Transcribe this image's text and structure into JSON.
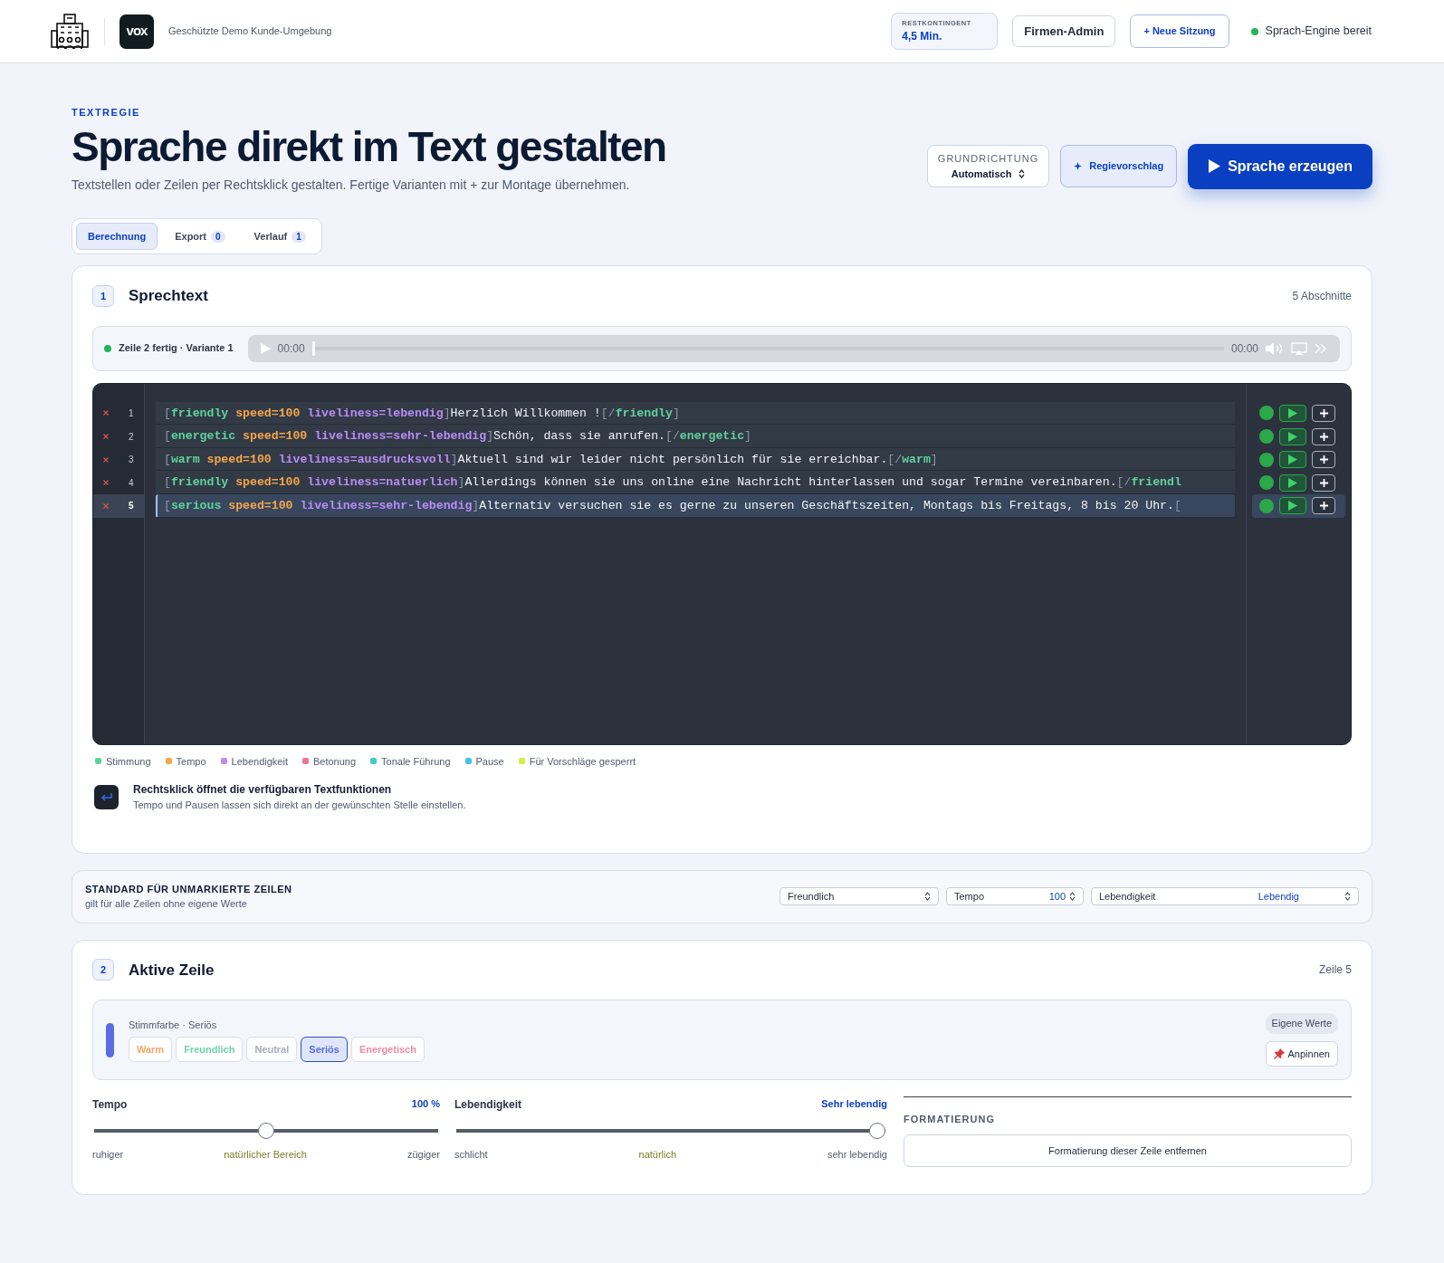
{
  "header": {
    "logo_text": "vox",
    "environment": "Geschützte Demo Kunde-Umgebung",
    "quota": {
      "label": "RESTKONTINGENT",
      "value": "4,5 Min."
    },
    "admin_button": "Firmen-Admin",
    "new_session_button": "+ Neue Sitzung",
    "engine_status": "Sprach-Engine bereit"
  },
  "intro": {
    "eyebrow": "TEXTREGIE",
    "title": "Sprache direkt im Text gestalten",
    "subtitle": "Textstellen oder Zeilen per Rechtsklick gestalten. Fertige Varianten mit + zur Montage übernehmen.",
    "direction": {
      "label": "GRUNDRICHTUNG",
      "value": "Automatisch"
    },
    "suggest_button": "Regievorschlag",
    "generate_button": "Sprache erzeugen"
  },
  "tabs": [
    {
      "label": "Berechnung",
      "selected": true
    },
    {
      "label": "Export",
      "count": "0",
      "selected": false
    },
    {
      "label": "Verlauf",
      "count": "1",
      "selected": false
    }
  ],
  "script_section": {
    "number": "1",
    "title": "Sprechtext",
    "meta": "5 Abschnitte",
    "player": {
      "status": "Zeile 2 fertig · Variante 1",
      "current_time": "00:00",
      "duration": "00:00"
    },
    "lines": [
      {
        "number": "1",
        "selected": false,
        "tokens": [
          {
            "kind": "punct",
            "text": "["
          },
          {
            "kind": "mood",
            "text": "friendly "
          },
          {
            "kind": "speed",
            "text": "speed=100 "
          },
          {
            "kind": "liveliness",
            "text": "liveliness=lebendig"
          },
          {
            "kind": "punct",
            "text": "]"
          },
          {
            "kind": "text",
            "text": "Herzlich Willkommen !"
          },
          {
            "kind": "punct",
            "text": "[/"
          },
          {
            "kind": "mood",
            "text": "friendly"
          },
          {
            "kind": "punct",
            "text": "]"
          }
        ]
      },
      {
        "number": "2",
        "selected": false,
        "tokens": [
          {
            "kind": "punct",
            "text": "["
          },
          {
            "kind": "mood",
            "text": "energetic "
          },
          {
            "kind": "speed",
            "text": "speed=100 "
          },
          {
            "kind": "liveliness",
            "text": "liveliness=sehr-lebendig"
          },
          {
            "kind": "punct",
            "text": "]"
          },
          {
            "kind": "text",
            "text": "Schön, dass sie anrufen."
          },
          {
            "kind": "punct",
            "text": "[/"
          },
          {
            "kind": "mood",
            "text": "energetic"
          },
          {
            "kind": "punct",
            "text": "]"
          }
        ]
      },
      {
        "number": "3",
        "selected": false,
        "tokens": [
          {
            "kind": "punct",
            "text": "["
          },
          {
            "kind": "mood",
            "text": "warm "
          },
          {
            "kind": "speed",
            "text": "speed=100 "
          },
          {
            "kind": "liveliness",
            "text": "liveliness=ausdrucksvoll"
          },
          {
            "kind": "punct",
            "text": "]"
          },
          {
            "kind": "text",
            "text": "Aktuell sind wir leider nicht persönlich für sie erreichbar."
          },
          {
            "kind": "punct",
            "text": "[/"
          },
          {
            "kind": "mood",
            "text": "warm"
          },
          {
            "kind": "punct",
            "text": "]"
          }
        ]
      },
      {
        "number": "4",
        "selected": false,
        "tokens": [
          {
            "kind": "punct",
            "text": "["
          },
          {
            "kind": "mood",
            "text": "friendly "
          },
          {
            "kind": "speed",
            "text": "speed=100 "
          },
          {
            "kind": "liveliness",
            "text": "liveliness=natuerlich"
          },
          {
            "kind": "punct",
            "text": "]"
          },
          {
            "kind": "text",
            "text": "Allerdings können sie uns online eine Nachricht hinterlassen und sogar Termine vereinbaren."
          },
          {
            "kind": "punct",
            "text": "[/"
          },
          {
            "kind": "mood",
            "text": "friendl"
          }
        ]
      },
      {
        "number": "5",
        "selected": true,
        "tokens": [
          {
            "kind": "punct",
            "text": "["
          },
          {
            "kind": "mood",
            "text": "serious "
          },
          {
            "kind": "speed",
            "text": "speed=100 "
          },
          {
            "kind": "liveliness",
            "text": "liveliness=sehr-lebendig"
          },
          {
            "kind": "punct",
            "text": "]"
          },
          {
            "kind": "text",
            "text": "Alternativ versuchen sie es gerne zu unseren Geschäftszeiten, Montags bis Freitags, 8 bis 20 Uhr."
          },
          {
            "kind": "punct",
            "text": "["
          }
        ]
      }
    ],
    "legend": [
      {
        "label": "Stimmung",
        "color": "#5fd39b"
      },
      {
        "label": "Tempo",
        "color": "#f5a54a"
      },
      {
        "label": "Lebendigkeit",
        "color": "#b98cf5"
      },
      {
        "label": "Betonung",
        "color": "#f0739a"
      },
      {
        "label": "Tonale Führung",
        "color": "#40cfc0"
      },
      {
        "label": "Pause",
        "color": "#4bc0e8"
      },
      {
        "label": "Für Vorschläge gesperrt",
        "color": "#d4f040"
      }
    ],
    "hint": {
      "title": "Rechtsklick öffnet die verfügbaren Textfunktionen",
      "text": "Tempo und Pausen lassen sich direkt an der gewünschten Stelle einstellen."
    }
  },
  "defaults": {
    "title": "STANDARD FÜR UNMARKIERTE ZEILEN",
    "subtitle": "gilt für alle Zeilen ohne eigene Werte",
    "mood": "Freundlich",
    "tempo_label": "Tempo",
    "tempo_value": "100",
    "liveliness_label": "Lebendigkeit",
    "liveliness_value": "Lebendig"
  },
  "active_section": {
    "number": "2",
    "title": "Aktive Zeile",
    "meta": "Zeile 5",
    "voice": {
      "label": "Stimmfarbe · Seriös",
      "badge": "Eigene Werte",
      "pin_button": "Anpinnen",
      "options": [
        {
          "label": "Warm",
          "color": "#f5a86a",
          "selected": false
        },
        {
          "label": "Freundlich",
          "color": "#6fd3a6",
          "selected": false
        },
        {
          "label": "Neutral",
          "color": "#a6adbb",
          "selected": false
        },
        {
          "label": "Seriös",
          "color": "#5b6be0",
          "selected": true
        },
        {
          "label": "Energetisch",
          "color": "#f28a9e",
          "selected": false
        }
      ]
    },
    "sliders": [
      {
        "label": "Tempo",
        "reading": "100 %",
        "level": 0.5,
        "scale": [
          "ruhiger",
          "natürlicher Bereich",
          "zügiger"
        ]
      },
      {
        "label": "Lebendigkeit",
        "reading": "Sehr lebendig",
        "level": 1,
        "scale": [
          "schlicht",
          "natürlich",
          "sehr lebendig"
        ]
      }
    ],
    "formatting": {
      "title": "FORMATIERUNG",
      "button": "Formatierung dieser Zeile entfernen"
    }
  }
}
